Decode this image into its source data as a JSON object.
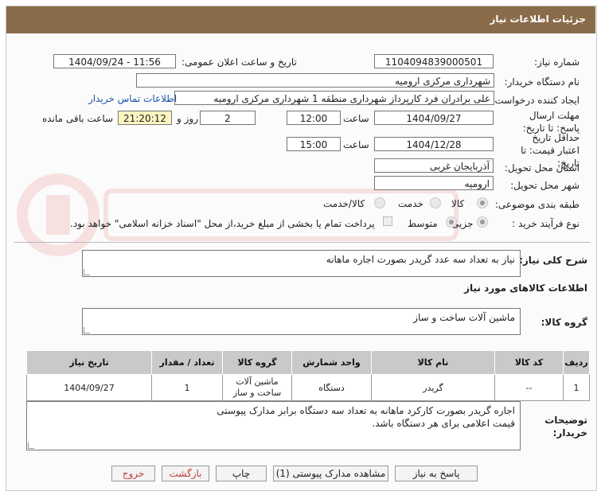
{
  "header": {
    "title": "جزئیات اطلاعات نیاز"
  },
  "form": {
    "need_number_label": "شماره نیاز:",
    "need_number": "1104094839000501",
    "announce_label": "تاریخ و ساعت اعلان عمومی:",
    "announce_value": "1404/09/24 - 11:56",
    "buyer_label": "نام دستگاه خریدار:",
    "buyer": "شهرداری مرکزی ارومیه",
    "creator_label": "ایجاد کننده درخواست:",
    "creator": "علی برادران فرد کارپرداز شهرداری منطقه 1 شهرداری مرکزی ارومیه",
    "contact_link": "اطلاعات تماس خریدار",
    "reply_deadline_label": "مهلت ارسال پاسخ: تا تاریخ:",
    "reply_date": "1404/09/27",
    "time_label": "ساعت",
    "reply_time": "12:00",
    "days": "2",
    "days_label": "روز و",
    "remaining": "21:20:12",
    "remaining_label": "ساعت باقی مانده",
    "validity_label": "حداقل تاریخ اعتبار قیمت: تا تاریخ:",
    "validity_date": "1404/12/28",
    "validity_time": "15:00",
    "province_label": "استان محل تحویل:",
    "province": "آذربایجان غربی",
    "city_label": "شهر محل تحویل:",
    "city": "ارومیه",
    "category_label": "طبقه بندی موضوعی:",
    "category_options": [
      "کالا",
      "خدمت",
      "کالا/خدمت"
    ],
    "category_selected": "کالا",
    "process_label": "نوع فرآیند خرید :",
    "process_options": [
      "جزیی",
      "متوسط"
    ],
    "process_selected": "جزیی",
    "payment_note": "پرداخت تمام یا بخشی از مبلغ خرید،از محل \"اسناد خزانه اسلامی\" خواهد بود."
  },
  "summary": {
    "label": "شرح کلی نیاز:",
    "value": "نیاز به تعداد سه عدد گریدر بصورت اجاره ماهانه"
  },
  "goods_section": {
    "title": "اطلاعات کالاهای مورد نیاز"
  },
  "goods_group": {
    "label": "گروه کالا:",
    "value": "ماشین آلات ساخت و ساز"
  },
  "table": {
    "headers": [
      "ردیف",
      "کد کالا",
      "نام کالا",
      "واحد شمارش",
      "گروه کالا",
      "تعداد / مقدار",
      "تاریخ نیاز"
    ],
    "rows": [
      [
        "1",
        "--",
        "گریدر",
        "دستگاه",
        "ماشین آلات ساخت و ساز",
        "1",
        "1404/09/27"
      ]
    ]
  },
  "buyer_notes": {
    "label": "توضیحات خریدار:",
    "line1": "اجاره گریدر بصورت کارکرد ماهانه به تعداد سه دستگاه برابر مدارک پیوستی",
    "line2": "قیمت اعلامی برای هر دستگاه باشد."
  },
  "buttons": {
    "reply": "پاسخ به نیاز",
    "attachments": "مشاهده مدارک پیوستی (1)",
    "print": "چاپ",
    "back": "بازگشت",
    "exit": "خروج"
  },
  "colors": {
    "header": "#8a6b49",
    "remaining_bg": "#fdf5c0",
    "link": "#1a55a8",
    "exit_text": "#c23c3c"
  }
}
